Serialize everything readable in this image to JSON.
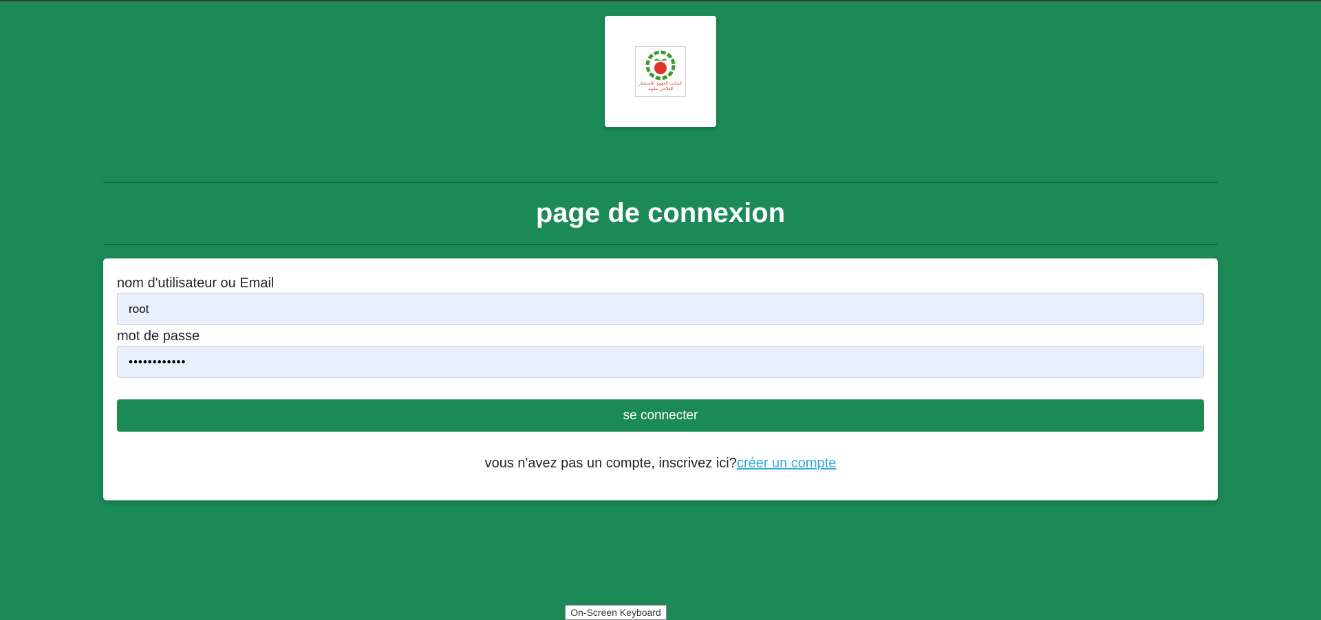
{
  "logo": {
    "icon": "organization-logo",
    "text_lines": [
      "المكتب الجهوي للاستثمار",
      "الفلاحي بملوية"
    ]
  },
  "page": {
    "title": "page de connexion"
  },
  "form": {
    "username_label": "nom d'utilisateur ou Email",
    "username_value": "root",
    "password_label": "mot de passe",
    "password_value": "••••••••••••",
    "submit_label": "se connecter",
    "signup_prompt": "vous n'avez pas un compte, inscrivez ici?",
    "signup_link": "créer un compte"
  },
  "taskbar": {
    "tooltip": "On-Screen Keyboard"
  },
  "colors": {
    "background": "#1b8a57",
    "button": "#1b8a57",
    "link": "#2fa8e0",
    "input_autofill": "#e8f0fe"
  }
}
